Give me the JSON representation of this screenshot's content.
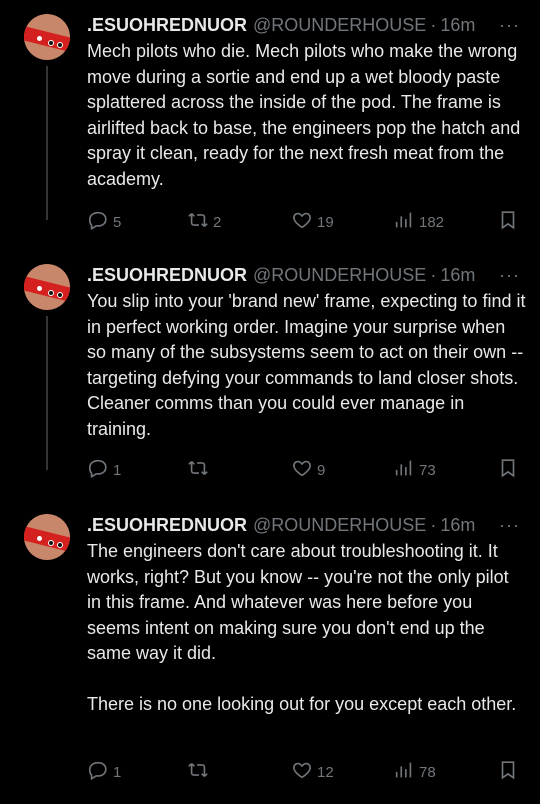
{
  "tweets": [
    {
      "name": ".ESUOHREDNUOR",
      "handle": "@ROUNDERHOUSE",
      "time": "16m",
      "text": "Mech pilots who die. Mech pilots who make the wrong move during a sortie and end up a wet bloody paste splattered across the inside of the pod. The frame is airlifted back to base, the engineers pop the hatch and spray it clean, ready for the next fresh meat from the academy.",
      "replies": "5",
      "retweets": "2",
      "likes": "19",
      "views": "182"
    },
    {
      "name": ".ESUOHREDNUOR",
      "handle": "@ROUNDERHOUSE",
      "time": "16m",
      "text": "You slip into your 'brand new' frame, expecting to find it in perfect working order. Imagine your surprise when so many of the subsystems seem to act on their own -- targeting defying your commands to land closer shots. Cleaner comms than you could ever manage in training.",
      "replies": "1",
      "retweets": "",
      "likes": "9",
      "views": "73"
    },
    {
      "name": ".ESUOHREDNUOR",
      "handle": "@ROUNDERHOUSE",
      "time": "16m",
      "text": "The engineers don't care about troubleshooting it. It works, right? But you know -- you're not the only pilot in this frame. And whatever was here before you seems intent on making sure you don't end up the same way it did.\n\nThere is no one looking out for you except each other.",
      "replies": "1",
      "retweets": "",
      "likes": "12",
      "views": "78"
    }
  ],
  "ui": {
    "separator": "·",
    "more_glyph": "···",
    "icons": [
      "avatar",
      "reply-icon",
      "retweet-icon",
      "like-icon",
      "views-icon",
      "bookmark-icon",
      "more-icon"
    ],
    "colors": {
      "background": "#000000",
      "text": "#e7e9ea",
      "muted": "#71767b",
      "thread_line": "#333639"
    }
  }
}
